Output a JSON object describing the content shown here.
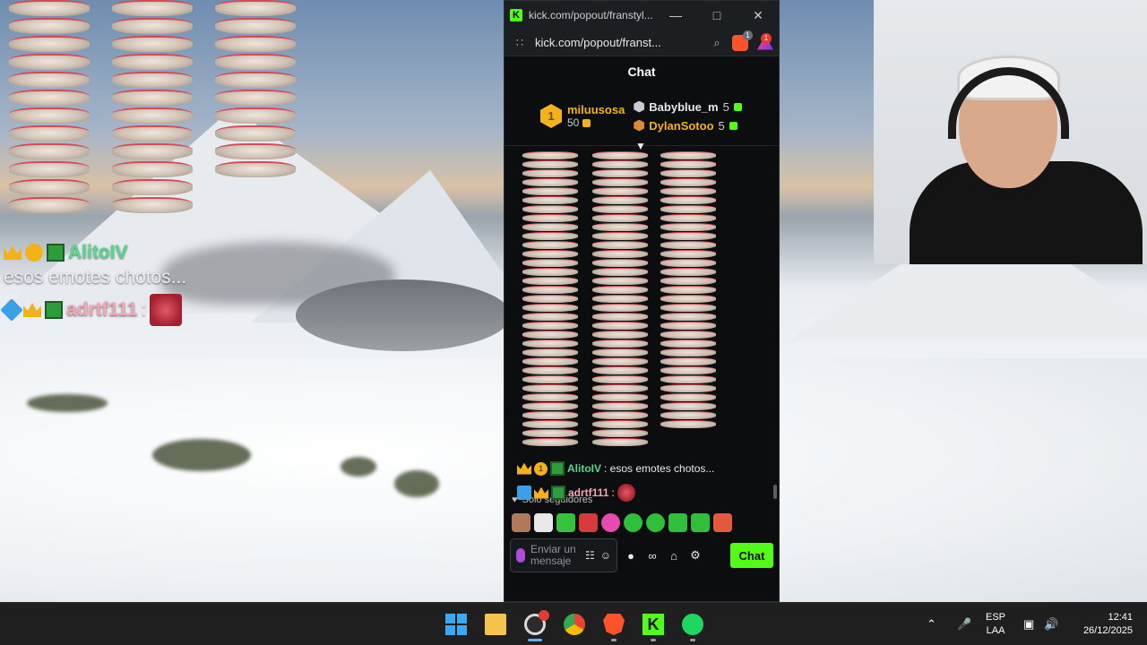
{
  "overlay": {
    "messages": [
      {
        "user": "AlitoIV",
        "text": "esos emotes chotos..."
      },
      {
        "user": "adrtf111",
        "text": ":"
      }
    ]
  },
  "chat_window": {
    "title": "kick.com/popout/franstyl...",
    "address": "kick.com/popout/franst...",
    "brave_badge": "1",
    "rewards_badge": "1",
    "header": "Chat",
    "leaderboard": {
      "first": {
        "rank": "1",
        "name": "miluusosa",
        "score": "50"
      },
      "others": [
        {
          "name": "Babyblue_m",
          "score": "5"
        },
        {
          "name": "DylanSotoo",
          "score": "5"
        }
      ]
    },
    "messages": [
      {
        "user": "AlitoIV",
        "text": ": esos emotes chotos..."
      },
      {
        "user": "adrtf111",
        "text": ":"
      }
    ],
    "followers_mode": "Solo seguidores",
    "input_placeholder": "Enviar un mensaje",
    "send_label": "Chat"
  },
  "taskbar": {
    "language": "ESP",
    "layout": "LAA",
    "time": "12:41",
    "date": "26/12/2025"
  },
  "colors": {
    "kick_green": "#53fc18",
    "gold": "#f3b21a",
    "user_green": "#54d88c",
    "user_pink": "#f2a6b6"
  }
}
